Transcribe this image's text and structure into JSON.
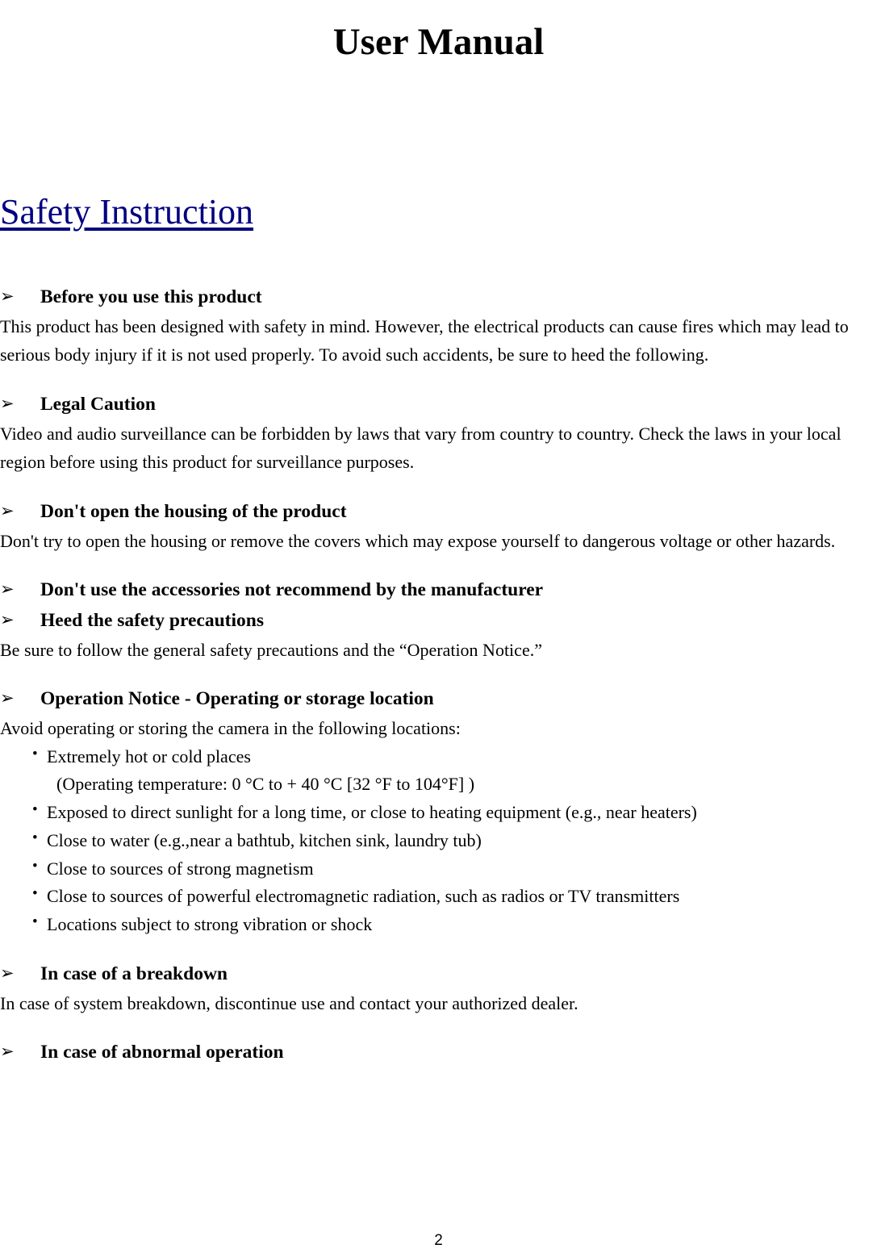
{
  "document": {
    "title": "User Manual",
    "page_number": "2",
    "section_heading": "Safety Instruction",
    "link_color": "#000080",
    "bullet_arrow_glyph": "➢",
    "bullet_dot_glyph": "•"
  },
  "sections": [
    {
      "heading": "Before you use this product",
      "body": "This product has been designed with safety in mind. However, the electrical products can cause fires which may lead to serious body injury if it is not used properly. To avoid such accidents, be sure to heed the following."
    },
    {
      "heading": "Legal Caution",
      "body": "Video and audio surveillance can be forbidden by laws that vary from country to country. Check the laws in your local region before using this product for surveillance purposes."
    },
    {
      "heading": "Don't open the housing of the product",
      "body": "Don't try to open the housing or remove the covers which may expose yourself to dangerous voltage or other hazards."
    },
    {
      "heading": "Don't use the accessories not recommend by the manufacturer",
      "body": ""
    },
    {
      "heading": "Heed the safety precautions",
      "body": "Be sure to follow the general safety precautions and the “Operation Notice.”"
    },
    {
      "heading": "Operation Notice - Operating or storage location",
      "body": "Avoid operating or storing the camera in the following locations:"
    },
    {
      "heading": "In case of a breakdown",
      "body": "In case of system breakdown, discontinue use and contact your authorized dealer."
    },
    {
      "heading": "In case of abnormal operation",
      "body": ""
    }
  ],
  "location_list": {
    "items": [
      "Extremely hot or cold places",
      "Exposed to direct sunlight for a long time, or close to heating equipment (e.g., near heaters)",
      "Close to water (e.g.,near a bathtub, kitchen sink, laundry tub)",
      "Close to sources of strong magnetism",
      "Close to sources of powerful electromagnetic radiation, such as radios or TV transmitters",
      "Locations subject to strong vibration or shock"
    ],
    "temperature_note": "(Operating temperature: 0 °C to + 40 °C [32 °F to 104°F] )"
  }
}
